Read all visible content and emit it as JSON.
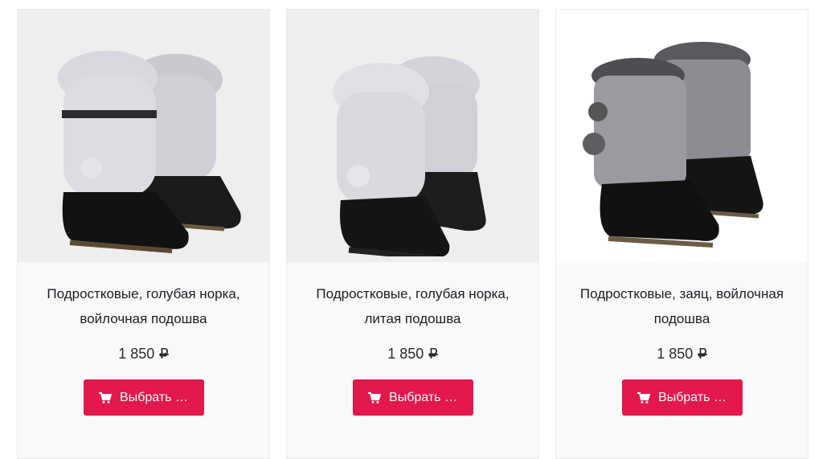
{
  "products": [
    {
      "title": "Подростковые, голубая норка, войлочная подошва",
      "price": "1 850",
      "currency": "₽",
      "button_label": "Выбрать …",
      "image_icon": "fur-boots-image"
    },
    {
      "title": "Подростковые, голубая норка, литая подошва",
      "price": "1 850",
      "currency": "₽",
      "button_label": "Выбрать …",
      "image_icon": "fur-boots-image"
    },
    {
      "title": "Подростковые, заяц, войлочная подошва",
      "price": "1 850",
      "currency": "₽",
      "button_label": "Выбрать …",
      "image_icon": "fur-boots-image"
    }
  ],
  "colors": {
    "button": "#e3184d",
    "card_bg": "#f9f9fa"
  }
}
